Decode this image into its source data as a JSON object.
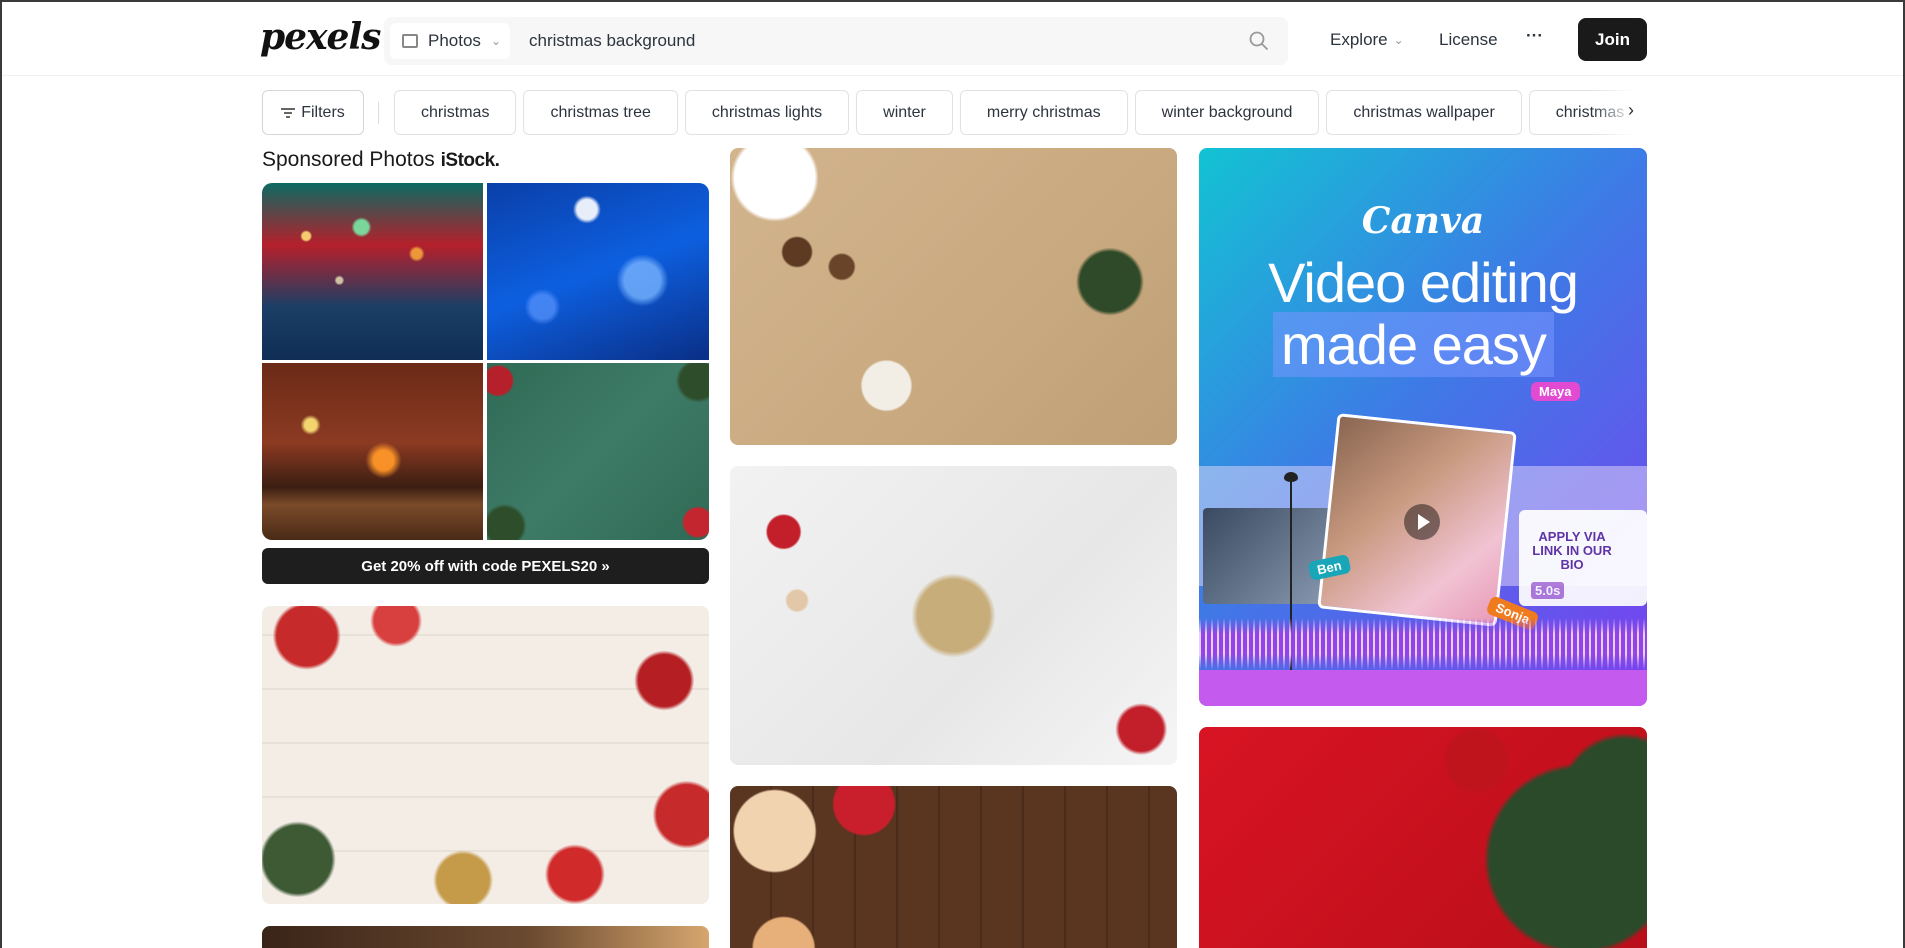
{
  "header": {
    "logo": "pexels",
    "search_type": "Photos",
    "search_query": "christmas background",
    "nav": {
      "explore": "Explore",
      "license": "License",
      "more": "···"
    },
    "join": "Join"
  },
  "filters": {
    "label": "Filters",
    "chips": [
      "christmas",
      "christmas tree",
      "christmas lights",
      "winter",
      "merry christmas",
      "winter background",
      "christmas wallpaper",
      "christmas"
    ]
  },
  "sponsored": {
    "title": "Sponsored Photos",
    "brand": "iStock.",
    "promo": "Get 20% off with code PEXELS20 »"
  },
  "canva_ad": {
    "logo": "Canva",
    "headline_1": "Video editing",
    "headline_2": "made easy",
    "tags": {
      "maya": "Maya",
      "ben": "Ben",
      "sonja": "Sonja"
    },
    "card_text": "APPLY VIA LINK IN OUR BIO",
    "duration": "5.0s"
  },
  "colors": {
    "accent": "#05a081",
    "dark": "#1a1a1a",
    "chip_border": "#e2e2e2"
  }
}
